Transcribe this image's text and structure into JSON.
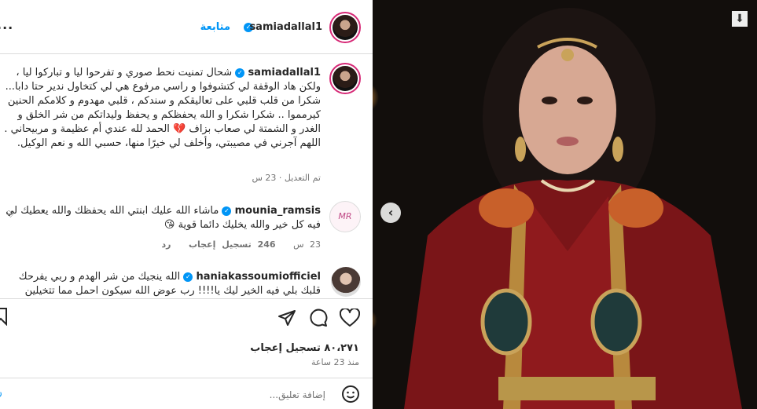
{
  "header": {
    "username": "samiadallal1",
    "follow_label": "متابعة",
    "more": "..."
  },
  "caption": {
    "username": "samiadallal1",
    "text": "شحال تمنيت نحط صوري و تفرحوا ليا و تباركوا ليا ، ولكن هاد الوقفة لي كتشوفوا و راسي مرفوع هي لي كتخاول ندير حتا دابا... شكرا من قلب قلبي على تعاليقكم و سندكم ، قلبي مهدوم و كلامكم الحنين كيرمموا .. شكرا شكرا و الله يحفظكم و يحفظ وليداتكم من شر الخلق و الغدر و الشمتة لي صعاب بزاف 💔 الحمد لله عندي أم عظيمة و مربيحاني . اللهم آجرني في مصيبتي، وأخلف لي خيرًا منها، حسبي الله و نعم الوكيل.",
    "meta": "تم التعديل · 23 س"
  },
  "comments": [
    {
      "username": "mounia_ramsis",
      "text": "ماشاء الله عليك ابنتي الله يحفظك والله يعطيك لي فيه كل خير والله يخليك دائما قوية 😘",
      "time": "23 س",
      "likes": "246 تسجيل إعجاب",
      "reply": "رد"
    },
    {
      "username": "haniakassoumiofficiel",
      "text": "الله ينجيك من شر الهدم و ربي يفرحك قلبك بلي فيه الخير ليك يا!!!! رب عوض الله سيكون احمل مما تتخيلين",
      "time": "",
      "likes": "",
      "reply": ""
    }
  ],
  "post": {
    "likes": "٨٠،٢٧١ تسجيل إعجاب",
    "time": "منذ 23 ساعة"
  },
  "add_comment": {
    "placeholder": "إضافة تعليق..."
  },
  "icons": {
    "like": "heart-icon",
    "comment": "comment-icon",
    "share": "send-icon",
    "save": "bookmark-icon",
    "emoji": "emoji-icon",
    "prev": "chevron-left-icon",
    "download": "download-icon"
  },
  "colors": {
    "accent": "#0095f6",
    "text": "#262626",
    "secondary": "#737373"
  }
}
